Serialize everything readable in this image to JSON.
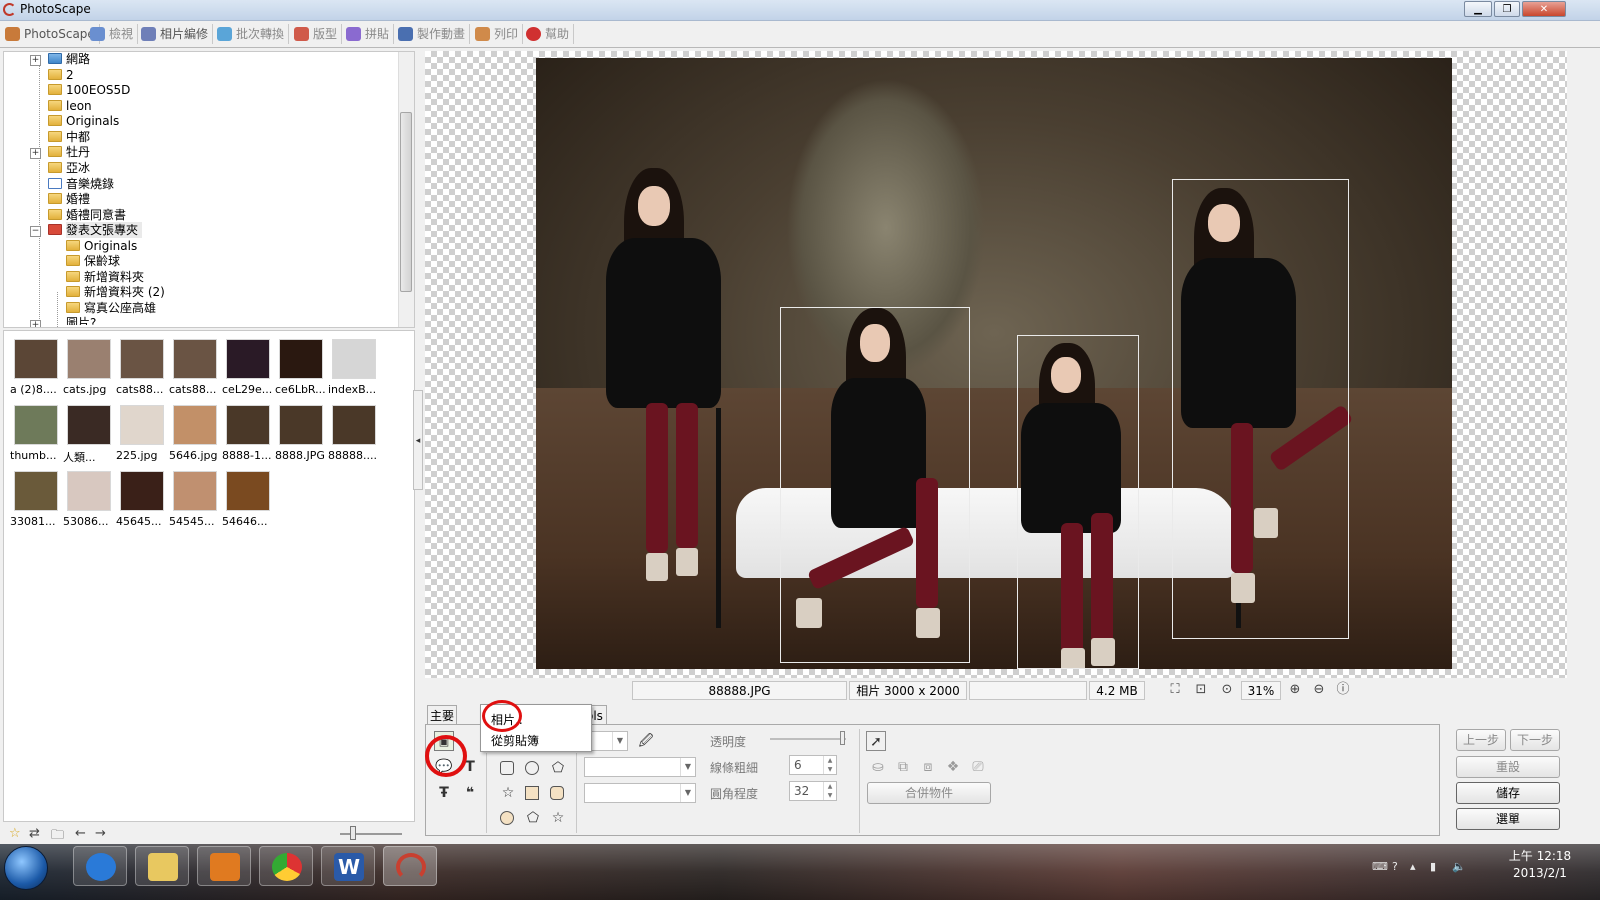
{
  "window": {
    "title": "PhotoScape",
    "min_label": "▁",
    "max_label": "❐",
    "close_label": "✕"
  },
  "tabs": [
    {
      "label": "PhotoScape",
      "icon": "photoscape-icon",
      "color": "#c87a3a"
    },
    {
      "label": "檢視",
      "icon": "viewer-icon",
      "color": "#6a8fd0"
    },
    {
      "label": "相片編修",
      "icon": "editor-icon",
      "color": "#6f7fb8"
    },
    {
      "label": "批次轉換",
      "icon": "batch-icon",
      "color": "#5aa5d8"
    },
    {
      "label": "版型",
      "icon": "page-icon",
      "color": "#d05a4a"
    },
    {
      "label": "拼貼",
      "icon": "combine-icon",
      "color": "#8a6ad0"
    },
    {
      "label": "製作動畫",
      "icon": "animated-gif-icon",
      "color": "#4a6fb0"
    },
    {
      "label": "列印",
      "icon": "print-icon",
      "color": "#d08a4a"
    },
    {
      "label": "幫助",
      "icon": "help-icon",
      "color": "#d03030"
    }
  ],
  "tree": {
    "items": [
      {
        "label": "網路",
        "icon": "network-icon"
      },
      {
        "label": "2"
      },
      {
        "label": "100EOS5D"
      },
      {
        "label": "leon"
      },
      {
        "label": "Originals"
      },
      {
        "label": "中都"
      },
      {
        "label": "牡丹"
      },
      {
        "label": "亞冰"
      },
      {
        "label": "音樂燒錄",
        "icon": "music-folder-icon"
      },
      {
        "label": "婚禮"
      },
      {
        "label": "婚禮同意書"
      },
      {
        "label": "發表文張專夾",
        "icon": "special-folder-icon"
      },
      {
        "label": "Originals"
      },
      {
        "label": "保齡球"
      },
      {
        "label": "新增資料夾"
      },
      {
        "label": "新增資料夾 (2)"
      },
      {
        "label": "寫真公座高雄"
      },
      {
        "label": "圖片?"
      }
    ]
  },
  "thumbnails": [
    {
      "label": "a (2)8....",
      "color": "#5b4636"
    },
    {
      "label": "cats.jpg",
      "color": "#9a8070"
    },
    {
      "label": "cats88...",
      "color": "#6a5444"
    },
    {
      "label": "cats88...",
      "color": "#6a5444"
    },
    {
      "label": "ceL29e...",
      "color": "#2a1a26"
    },
    {
      "label": "ce6LbR...",
      "color": "#2a1810"
    },
    {
      "label": "indexB...",
      "color": "#d6d6d6"
    },
    {
      "label": "thumb...",
      "color": "#6e7a5a"
    },
    {
      "label": "人類...",
      "color": "#3a2a24"
    },
    {
      "label": "225.jpg",
      "color": "#e0d6cc"
    },
    {
      "label": "5646.jpg",
      "color": "#c29068"
    },
    {
      "label": "8888-1...",
      "color": "#4a3828"
    },
    {
      "label": "8888.JPG",
      "color": "#4a3828"
    },
    {
      "label": "88888....",
      "color": "#4a3828"
    },
    {
      "label": "33081...",
      "color": "#6a5a3a"
    },
    {
      "label": "53086...",
      "color": "#d8c8c0"
    },
    {
      "label": "45645...",
      "color": "#3a2018"
    },
    {
      "label": "54545...",
      "color": "#c09070"
    },
    {
      "label": "54646...",
      "color": "#7a4a20"
    }
  ],
  "statusbar": {
    "filename": "88888.JPG",
    "dimensions": "相片 3000 x 2000",
    "filesize": "4.2 MB",
    "zoom": "31%"
  },
  "panel": {
    "tab_home": "主要",
    "tab_tools": "ols",
    "opacity_label": "透明度",
    "line_width_label": "線條粗細",
    "line_width_value": "6",
    "corner_label": "圓角程度",
    "corner_value": "32",
    "merge_button": "合併物件",
    "undo_button": "上一步",
    "redo_button": "下一步",
    "reset_button": "重設",
    "save_button": "儲存",
    "menu_button": "選單"
  },
  "popup_menu": {
    "items": [
      "相片..",
      "從剪貼簿"
    ]
  },
  "taskbar": {
    "apps": [
      {
        "name": "internet-explorer",
        "color": "#2a7ad8"
      },
      {
        "name": "file-explorer",
        "color": "#e8c860"
      },
      {
        "name": "media-player",
        "color": "#e07a20"
      },
      {
        "name": "chrome",
        "color": "#3ca040"
      },
      {
        "name": "word",
        "color": "#2a5aa8"
      },
      {
        "name": "photoscape",
        "color": "#c84030"
      }
    ],
    "clock_time": "上午 12:18",
    "clock_date": "2013/2/1"
  }
}
